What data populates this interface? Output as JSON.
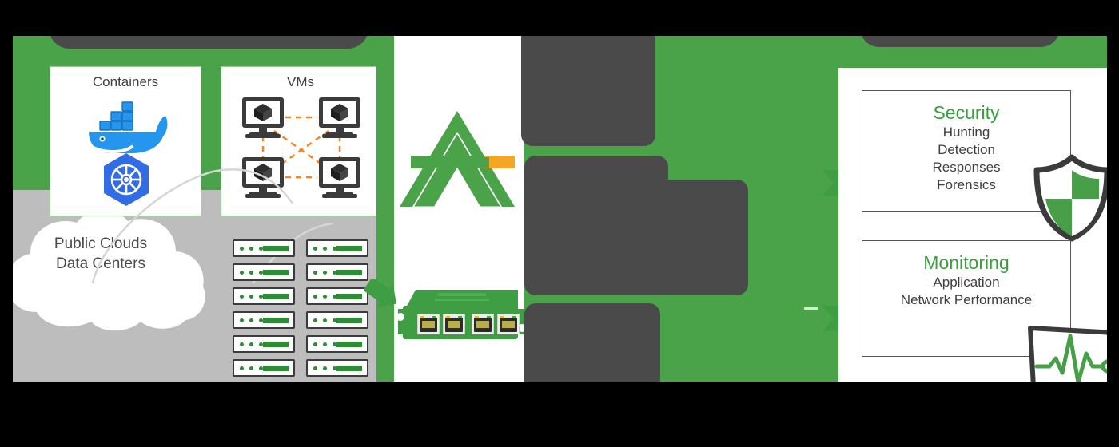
{
  "diagram": {
    "title_hidden": "",
    "colors": {
      "green": "#4aa249",
      "accent_green": "#35a13a",
      "gray_slab": "#bdbdbd",
      "redaction": "#4a4a4a",
      "orange": "#f5861f",
      "docker_blue": "#2496ED",
      "k8s_blue": "#326CE5",
      "dark": "#3b3b3b"
    },
    "left": {
      "containers_box": {
        "label": "Containers",
        "icons": [
          "docker-whale-icon",
          "kubernetes-helm-icon"
        ]
      },
      "vms_box": {
        "label": "VMs",
        "icons": [
          "vm-monitor-icon",
          "vm-monitor-icon",
          "vm-monitor-icon",
          "vm-monitor-icon"
        ]
      },
      "cloud": {
        "line1": "Public Clouds",
        "line2": "Data Centers"
      },
      "server_rack": {
        "columns": 2,
        "rows": 6,
        "indicator_dots": 3
      }
    },
    "center": {
      "logo": "arkime-triangle-logo",
      "tap_device": {
        "name": "network-tap-device",
        "ports": 4
      }
    },
    "right": {
      "boxes": [
        {
          "title": "Security",
          "lines": [
            "Hunting",
            "Detection",
            "Responses",
            "Forensics"
          ],
          "icon": "shield-icon"
        },
        {
          "title": "Monitoring",
          "lines": [
            "Application",
            "Network Performance"
          ],
          "icon": "heartbeat-monitor-icon"
        }
      ]
    }
  }
}
